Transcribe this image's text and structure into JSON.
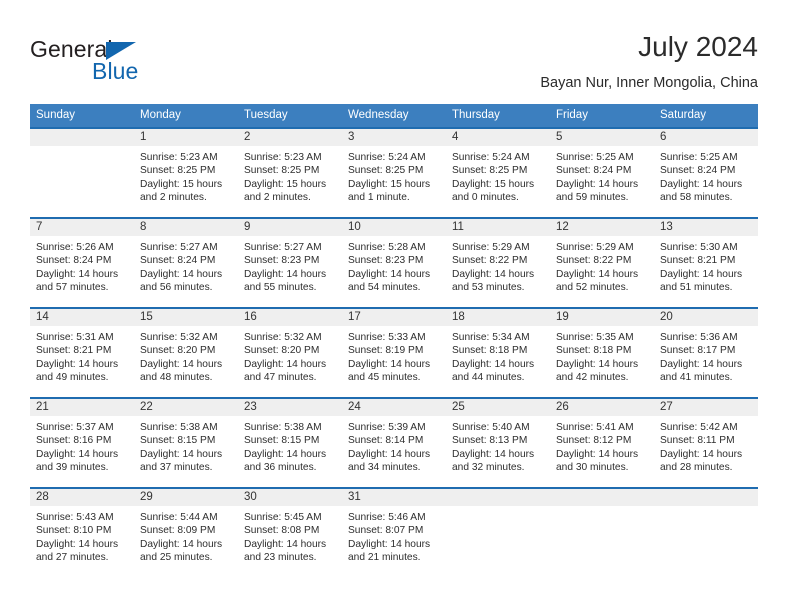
{
  "brand": {
    "name_top": "General",
    "name_bottom": "Blue",
    "triangle_color": "#1266ae"
  },
  "header": {
    "title": "July 2024",
    "subtitle": "Bayan Nur, Inner Mongolia, China"
  },
  "theme": {
    "header_blue": "#3c7fbf",
    "separator_blue": "#1f6cb0",
    "daynum_band": "#efefef",
    "text": "#2e2e2e"
  },
  "weekday_headers": [
    "Sunday",
    "Monday",
    "Tuesday",
    "Wednesday",
    "Thursday",
    "Friday",
    "Saturday"
  ],
  "weeks": [
    [
      {
        "day": "",
        "sunrise": "",
        "sunset": "",
        "daylight_1": "",
        "daylight_2": ""
      },
      {
        "day": "1",
        "sunrise": "Sunrise: 5:23 AM",
        "sunset": "Sunset: 8:25 PM",
        "daylight_1": "Daylight: 15 hours",
        "daylight_2": "and 2 minutes."
      },
      {
        "day": "2",
        "sunrise": "Sunrise: 5:23 AM",
        "sunset": "Sunset: 8:25 PM",
        "daylight_1": "Daylight: 15 hours",
        "daylight_2": "and 2 minutes."
      },
      {
        "day": "3",
        "sunrise": "Sunrise: 5:24 AM",
        "sunset": "Sunset: 8:25 PM",
        "daylight_1": "Daylight: 15 hours",
        "daylight_2": "and 1 minute."
      },
      {
        "day": "4",
        "sunrise": "Sunrise: 5:24 AM",
        "sunset": "Sunset: 8:25 PM",
        "daylight_1": "Daylight: 15 hours",
        "daylight_2": "and 0 minutes."
      },
      {
        "day": "5",
        "sunrise": "Sunrise: 5:25 AM",
        "sunset": "Sunset: 8:24 PM",
        "daylight_1": "Daylight: 14 hours",
        "daylight_2": "and 59 minutes."
      },
      {
        "day": "6",
        "sunrise": "Sunrise: 5:25 AM",
        "sunset": "Sunset: 8:24 PM",
        "daylight_1": "Daylight: 14 hours",
        "daylight_2": "and 58 minutes."
      }
    ],
    [
      {
        "day": "7",
        "sunrise": "Sunrise: 5:26 AM",
        "sunset": "Sunset: 8:24 PM",
        "daylight_1": "Daylight: 14 hours",
        "daylight_2": "and 57 minutes."
      },
      {
        "day": "8",
        "sunrise": "Sunrise: 5:27 AM",
        "sunset": "Sunset: 8:24 PM",
        "daylight_1": "Daylight: 14 hours",
        "daylight_2": "and 56 minutes."
      },
      {
        "day": "9",
        "sunrise": "Sunrise: 5:27 AM",
        "sunset": "Sunset: 8:23 PM",
        "daylight_1": "Daylight: 14 hours",
        "daylight_2": "and 55 minutes."
      },
      {
        "day": "10",
        "sunrise": "Sunrise: 5:28 AM",
        "sunset": "Sunset: 8:23 PM",
        "daylight_1": "Daylight: 14 hours",
        "daylight_2": "and 54 minutes."
      },
      {
        "day": "11",
        "sunrise": "Sunrise: 5:29 AM",
        "sunset": "Sunset: 8:22 PM",
        "daylight_1": "Daylight: 14 hours",
        "daylight_2": "and 53 minutes."
      },
      {
        "day": "12",
        "sunrise": "Sunrise: 5:29 AM",
        "sunset": "Sunset: 8:22 PM",
        "daylight_1": "Daylight: 14 hours",
        "daylight_2": "and 52 minutes."
      },
      {
        "day": "13",
        "sunrise": "Sunrise: 5:30 AM",
        "sunset": "Sunset: 8:21 PM",
        "daylight_1": "Daylight: 14 hours",
        "daylight_2": "and 51 minutes."
      }
    ],
    [
      {
        "day": "14",
        "sunrise": "Sunrise: 5:31 AM",
        "sunset": "Sunset: 8:21 PM",
        "daylight_1": "Daylight: 14 hours",
        "daylight_2": "and 49 minutes."
      },
      {
        "day": "15",
        "sunrise": "Sunrise: 5:32 AM",
        "sunset": "Sunset: 8:20 PM",
        "daylight_1": "Daylight: 14 hours",
        "daylight_2": "and 48 minutes."
      },
      {
        "day": "16",
        "sunrise": "Sunrise: 5:32 AM",
        "sunset": "Sunset: 8:20 PM",
        "daylight_1": "Daylight: 14 hours",
        "daylight_2": "and 47 minutes."
      },
      {
        "day": "17",
        "sunrise": "Sunrise: 5:33 AM",
        "sunset": "Sunset: 8:19 PM",
        "daylight_1": "Daylight: 14 hours",
        "daylight_2": "and 45 minutes."
      },
      {
        "day": "18",
        "sunrise": "Sunrise: 5:34 AM",
        "sunset": "Sunset: 8:18 PM",
        "daylight_1": "Daylight: 14 hours",
        "daylight_2": "and 44 minutes."
      },
      {
        "day": "19",
        "sunrise": "Sunrise: 5:35 AM",
        "sunset": "Sunset: 8:18 PM",
        "daylight_1": "Daylight: 14 hours",
        "daylight_2": "and 42 minutes."
      },
      {
        "day": "20",
        "sunrise": "Sunrise: 5:36 AM",
        "sunset": "Sunset: 8:17 PM",
        "daylight_1": "Daylight: 14 hours",
        "daylight_2": "and 41 minutes."
      }
    ],
    [
      {
        "day": "21",
        "sunrise": "Sunrise: 5:37 AM",
        "sunset": "Sunset: 8:16 PM",
        "daylight_1": "Daylight: 14 hours",
        "daylight_2": "and 39 minutes."
      },
      {
        "day": "22",
        "sunrise": "Sunrise: 5:38 AM",
        "sunset": "Sunset: 8:15 PM",
        "daylight_1": "Daylight: 14 hours",
        "daylight_2": "and 37 minutes."
      },
      {
        "day": "23",
        "sunrise": "Sunrise: 5:38 AM",
        "sunset": "Sunset: 8:15 PM",
        "daylight_1": "Daylight: 14 hours",
        "daylight_2": "and 36 minutes."
      },
      {
        "day": "24",
        "sunrise": "Sunrise: 5:39 AM",
        "sunset": "Sunset: 8:14 PM",
        "daylight_1": "Daylight: 14 hours",
        "daylight_2": "and 34 minutes."
      },
      {
        "day": "25",
        "sunrise": "Sunrise: 5:40 AM",
        "sunset": "Sunset: 8:13 PM",
        "daylight_1": "Daylight: 14 hours",
        "daylight_2": "and 32 minutes."
      },
      {
        "day": "26",
        "sunrise": "Sunrise: 5:41 AM",
        "sunset": "Sunset: 8:12 PM",
        "daylight_1": "Daylight: 14 hours",
        "daylight_2": "and 30 minutes."
      },
      {
        "day": "27",
        "sunrise": "Sunrise: 5:42 AM",
        "sunset": "Sunset: 8:11 PM",
        "daylight_1": "Daylight: 14 hours",
        "daylight_2": "and 28 minutes."
      }
    ],
    [
      {
        "day": "28",
        "sunrise": "Sunrise: 5:43 AM",
        "sunset": "Sunset: 8:10 PM",
        "daylight_1": "Daylight: 14 hours",
        "daylight_2": "and 27 minutes."
      },
      {
        "day": "29",
        "sunrise": "Sunrise: 5:44 AM",
        "sunset": "Sunset: 8:09 PM",
        "daylight_1": "Daylight: 14 hours",
        "daylight_2": "and 25 minutes."
      },
      {
        "day": "30",
        "sunrise": "Sunrise: 5:45 AM",
        "sunset": "Sunset: 8:08 PM",
        "daylight_1": "Daylight: 14 hours",
        "daylight_2": "and 23 minutes."
      },
      {
        "day": "31",
        "sunrise": "Sunrise: 5:46 AM",
        "sunset": "Sunset: 8:07 PM",
        "daylight_1": "Daylight: 14 hours",
        "daylight_2": "and 21 minutes."
      },
      {
        "day": "",
        "sunrise": "",
        "sunset": "",
        "daylight_1": "",
        "daylight_2": ""
      },
      {
        "day": "",
        "sunrise": "",
        "sunset": "",
        "daylight_1": "",
        "daylight_2": ""
      },
      {
        "day": "",
        "sunrise": "",
        "sunset": "",
        "daylight_1": "",
        "daylight_2": ""
      }
    ]
  ]
}
